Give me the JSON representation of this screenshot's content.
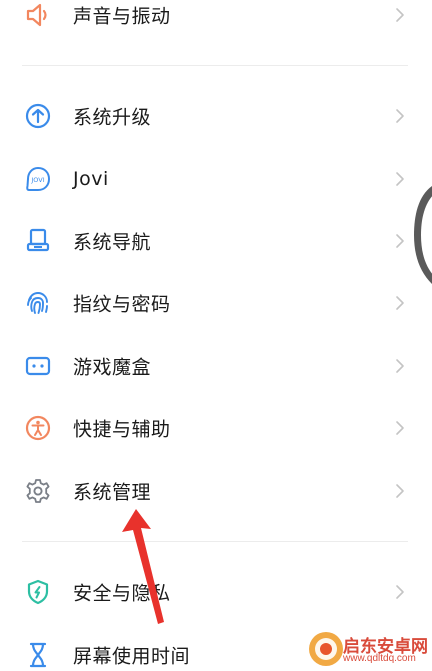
{
  "settings": {
    "items": [
      {
        "label": "声音与振动",
        "icon": "speaker-icon",
        "color": "#F2875F"
      },
      {
        "label": "系统升级",
        "icon": "upgrade-arrow-icon",
        "color": "#3A8BEA"
      },
      {
        "label": "Jovi",
        "icon": "jovi-icon",
        "color": "#3A8BEA"
      },
      {
        "label": "系统导航",
        "icon": "navigation-icon",
        "color": "#3A8BEA"
      },
      {
        "label": "指纹与密码",
        "icon": "fingerprint-icon",
        "color": "#3A8BEA"
      },
      {
        "label": "游戏魔盒",
        "icon": "game-box-icon",
        "color": "#3A8BEA"
      },
      {
        "label": "快捷与辅助",
        "icon": "accessibility-icon",
        "color": "#F2875F"
      },
      {
        "label": "系统管理",
        "icon": "gear-icon",
        "color": "#7A7F87"
      },
      {
        "label": "安全与隐私",
        "icon": "shield-icon",
        "color": "#2DBFA3"
      },
      {
        "label": "屏幕使用时间",
        "icon": "hourglass-icon",
        "color": "#3A8BEA"
      }
    ]
  },
  "watermark": {
    "title": "启东安卓网",
    "url": "www.qdltdq.com"
  }
}
